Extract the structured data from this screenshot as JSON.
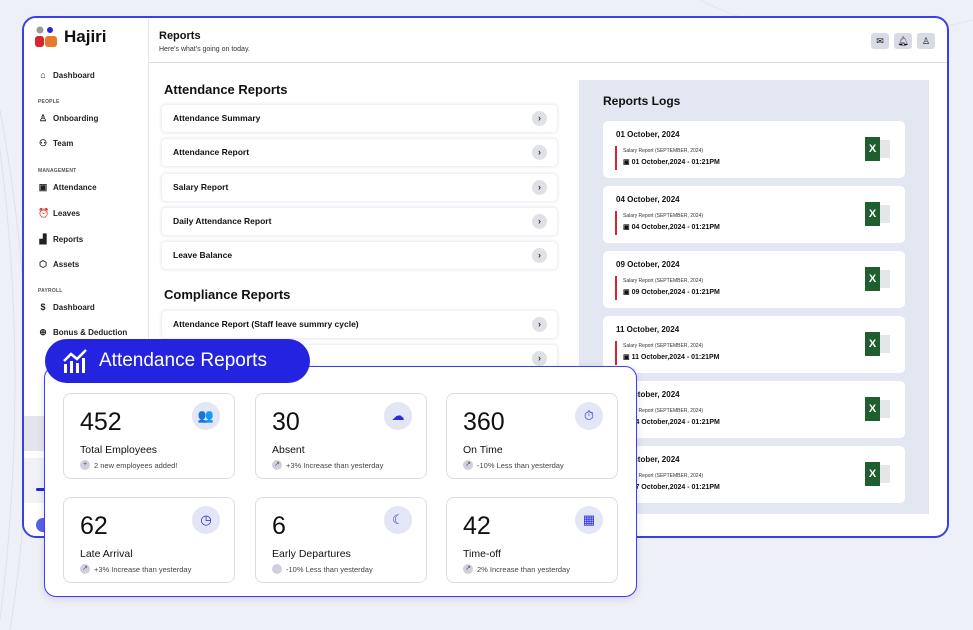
{
  "app": {
    "name": "Hajiri"
  },
  "sidebar": {
    "items": [
      {
        "label": "Dashboard",
        "icon": "home-icon",
        "glyph": "⌂"
      },
      {
        "section": "PEOPLE"
      },
      {
        "label": "Onboarding",
        "icon": "user-plus-icon",
        "glyph": "♙"
      },
      {
        "label": "Team",
        "icon": "team-icon",
        "glyph": "⚇"
      },
      {
        "section": "MANAGEMENT"
      },
      {
        "label": "Attendance",
        "icon": "calendar-check-icon",
        "glyph": "▣"
      },
      {
        "label": "Leaves",
        "icon": "alarm-icon",
        "glyph": "⏰"
      },
      {
        "label": "Reports",
        "icon": "bar-chart-icon",
        "glyph": "▟"
      },
      {
        "label": "Assets",
        "icon": "box-icon",
        "glyph": "⬡"
      },
      {
        "section": "PAYROLL"
      },
      {
        "label": "Dashboard",
        "icon": "dollar-icon",
        "glyph": "$"
      },
      {
        "label": "Bonus & Deduction",
        "icon": "gift-icon",
        "glyph": "⊕"
      }
    ]
  },
  "header": {
    "title": "Reports",
    "subtitle": "Here's what's going on today."
  },
  "attendance_reports": {
    "title": "Attendance Reports",
    "items": [
      "Attendance Summary",
      "Attendance Report",
      "Salary Report",
      "Daily Attendance Report",
      "Leave Balance"
    ]
  },
  "compliance_reports": {
    "title": "Compliance Reports",
    "items": [
      "Attendance Report (Staff leave summry cycle)",
      ""
    ]
  },
  "logs": {
    "title": "Reports Logs",
    "entries": [
      {
        "date": "01 October, 2024",
        "type": "Salary Report (SEPTEMBER, 2024)",
        "time": "01 October,2024 - 01:21PM"
      },
      {
        "date": "04 October, 2024",
        "type": "Salary Report (SEPTEMBER, 2024)",
        "time": "04 October,2024 - 01:21PM"
      },
      {
        "date": "09 October, 2024",
        "type": "Salary Report (SEPTEMBER, 2024)",
        "time": "09 October,2024 - 01:21PM"
      },
      {
        "date": "11 October, 2024",
        "type": "Salary Report (SEPTEMBER, 2024)",
        "time": "11 October,2024 - 01:21PM"
      },
      {
        "date": "14 October, 2024",
        "type": "Salary Report (SEPTEMBER, 2024)",
        "time": "14 October,2024 - 01:21PM"
      },
      {
        "date": "17 October, 2024",
        "type": "Salary Report (SEPTEMBER, 2024)",
        "time": "17 October,2024 - 01:21PM"
      }
    ]
  },
  "overlay": {
    "title": "Attendance Reports",
    "stats": [
      {
        "value": "452",
        "label": "Total Employees",
        "note": "2 new employees added!",
        "icon": "users-icon",
        "glyph": "👥",
        "badge": "+"
      },
      {
        "value": "30",
        "label": "Absent",
        "note": "+3% Increase than yesterday",
        "icon": "cloud-clock-icon",
        "glyph": "☁",
        "badge": "↗"
      },
      {
        "value": "360",
        "label": "On Time",
        "note": "-10% Less than yesterday",
        "icon": "stopwatch-icon",
        "glyph": "⏱",
        "badge": "↗"
      },
      {
        "value": "62",
        "label": "Late Arrival",
        "note": "+3% Increase than yesterday",
        "icon": "clock-x-icon",
        "glyph": "◷",
        "badge": "↗"
      },
      {
        "value": "6",
        "label": "Early Departures",
        "note": "-10% Less than yesterday",
        "icon": "moon-icon",
        "glyph": "☾",
        "badge": ""
      },
      {
        "value": "42",
        "label": "Time-off",
        "note": "2% Increase than yesterday",
        "icon": "calendar-clock-icon",
        "glyph": "▦",
        "badge": "↗"
      }
    ]
  },
  "colors": {
    "accent": "#2424e0",
    "excel": "#1e5e2f",
    "log_bar": "#d9232e"
  }
}
